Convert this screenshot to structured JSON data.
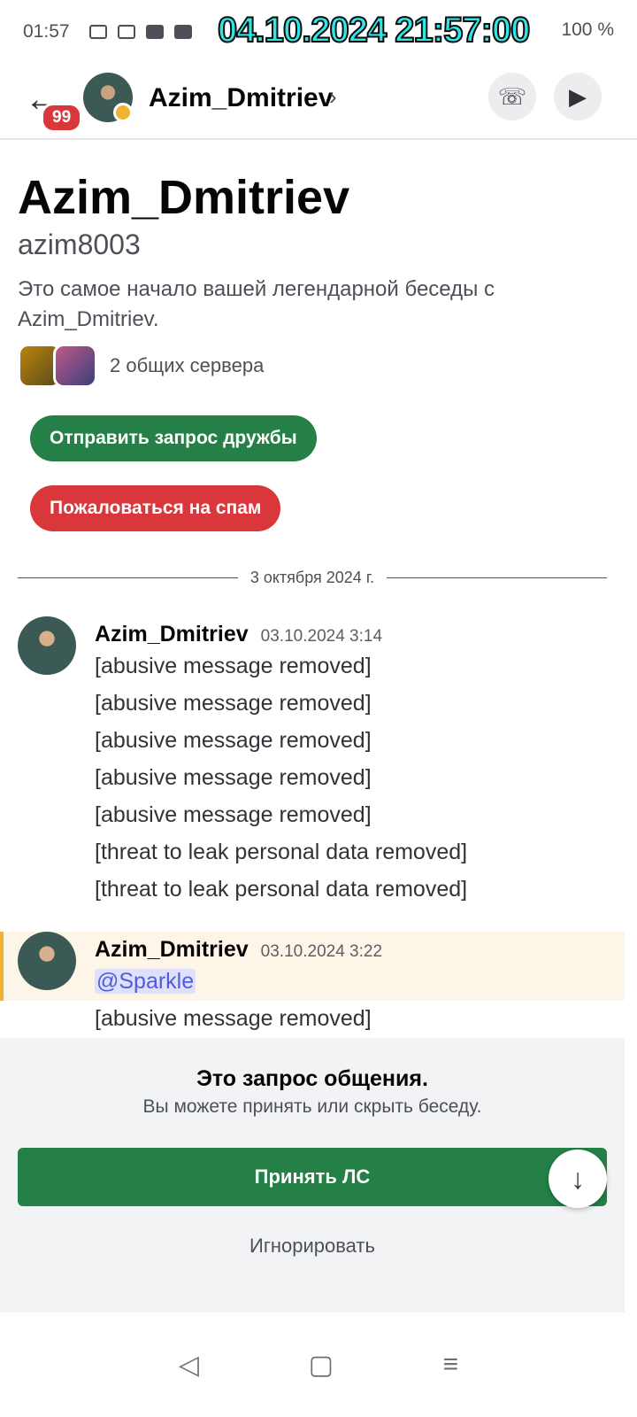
{
  "status_bar": {
    "time": "01:57",
    "overlay_timestamp": "04.10.2024 21:57:00",
    "battery": "100 %"
  },
  "header": {
    "back_icon": "arrow-left-icon",
    "unread_badge": "99",
    "display_name": "Azim_Dmitriev",
    "status_color": "#f0b232",
    "call_icon": "phone-icon",
    "video_icon": "video-camera-icon"
  },
  "profile": {
    "name": "Azim_Dmitriev",
    "handle": "azim8003",
    "intro": "Это самое начало вашей легендарной беседы с Azim_Dmitriev.",
    "mutual_servers": "2 общих сервера",
    "friend_request_label": "Отправить запрос дружбы",
    "report_spam_label": "Пожаловаться на спам"
  },
  "date_divider": "3 октября 2024 г.",
  "messages": [
    {
      "author": "Azim_Dmitriev",
      "time": "03.10.2024 3:14",
      "lines": [
        "[abusive message removed]",
        "[abusive message removed]",
        "[abusive message removed]",
        "[abusive message removed]",
        "[abusive message removed]",
        "[threat to leak personal data removed]",
        "[threat to leak personal data removed]"
      ]
    },
    {
      "author": "Azim_Dmitriev",
      "time": "03.10.2024 3:22",
      "mention": "@Sparkle",
      "lines": [
        "[abusive message removed]"
      ]
    }
  ],
  "request_panel": {
    "title": "Это запрос общения.",
    "subtitle": "Вы можете принять или скрыть беседу.",
    "accept_label": "Принять ЛС",
    "ignore_label": "Игнорировать"
  },
  "colors": {
    "accent_green": "#248046",
    "danger_red": "#da373c",
    "mention_bg": "#fdf6e8",
    "mention_bar": "#f0b232"
  }
}
